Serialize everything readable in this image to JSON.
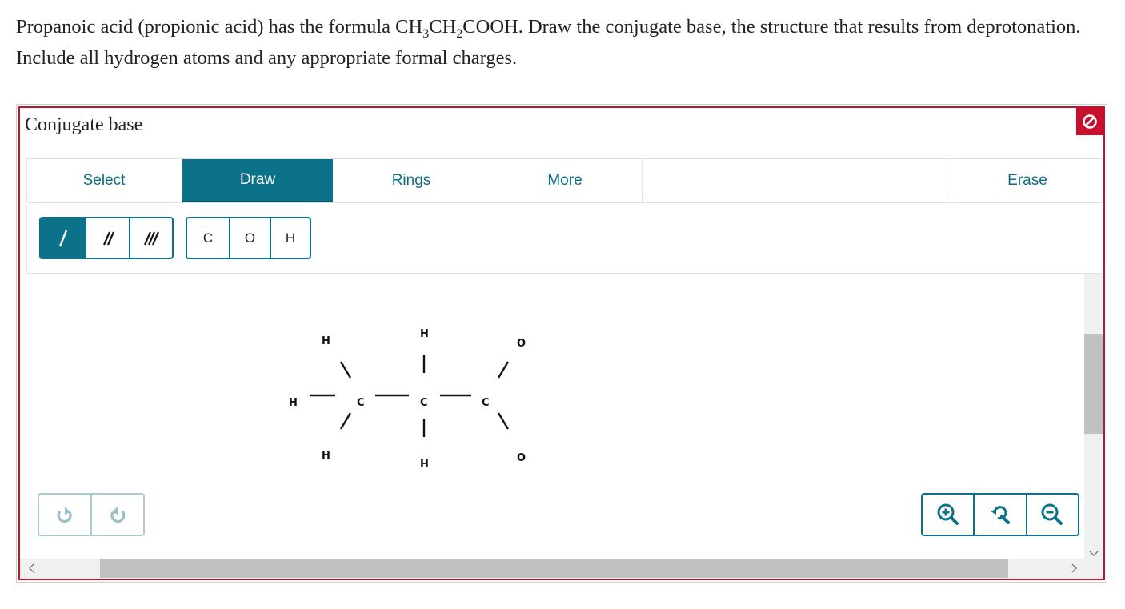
{
  "question": {
    "part1": "Propanoic acid (propionic acid) has the formula CH",
    "sub1": "3",
    "part2": "CH",
    "sub2": "2",
    "part3": "COOH. Draw the conjugate base, the structure that results from deprotonation. Include all hydrogen atoms and any appropriate formal charges."
  },
  "panel": {
    "title": "Conjugate base",
    "flag_icon": "no-entry-icon",
    "accent": "#c8102e"
  },
  "tabs": {
    "select": "Select",
    "draw": "Draw",
    "rings": "Rings",
    "more": "More",
    "erase": "Erase",
    "active": "Draw"
  },
  "bonds": {
    "single": "/",
    "double": "//",
    "triple": "///",
    "selected": "single"
  },
  "atoms": {
    "c": "C",
    "o": "O",
    "h": "H"
  },
  "molecule": {
    "atoms": {
      "h_top_left": "H",
      "h_left": "H",
      "h_bottom_left": "H",
      "c1": "C",
      "h_top_mid": "H",
      "c2": "C",
      "h_bottom_mid": "H",
      "c3": "C",
      "o_top": "O",
      "o_bottom": "O"
    }
  },
  "history": {
    "undo_icon": "undo-icon",
    "redo_icon": "redo-icon"
  },
  "zoom": {
    "in_icon": "zoom-in-icon",
    "reset_icon": "zoom-reset-icon",
    "out_icon": "zoom-out-icon"
  },
  "colors": {
    "primary": "#0b7289",
    "border_alert": "#c8102e"
  }
}
